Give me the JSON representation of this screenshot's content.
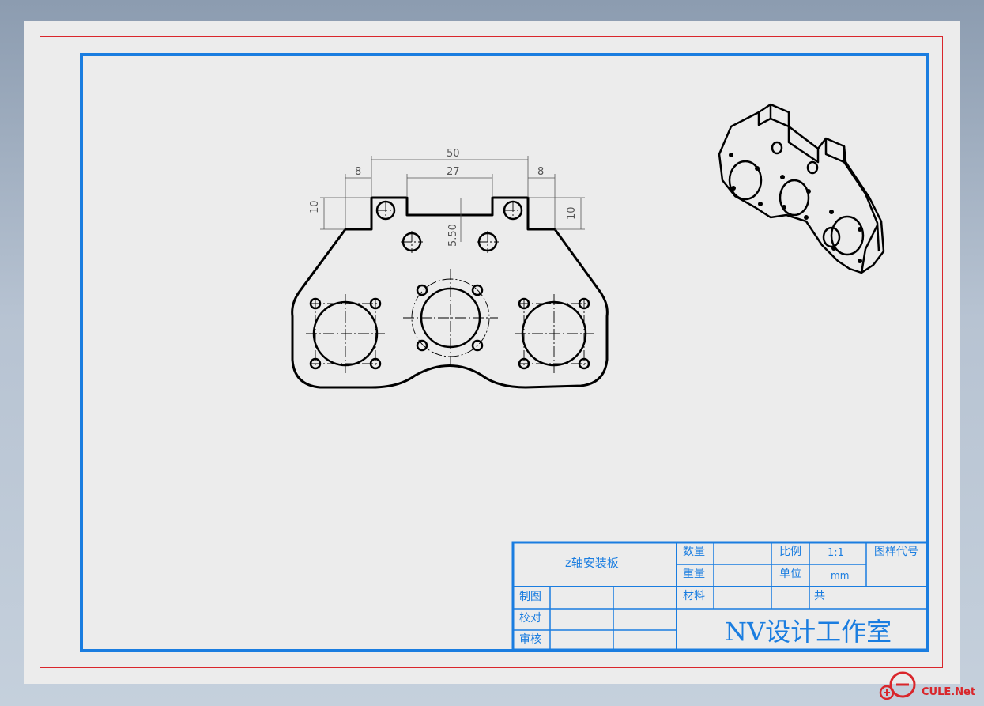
{
  "drawing": {
    "dimensions": {
      "overall_width": "50",
      "inner_width": "27",
      "left_offset": "8",
      "right_offset": "8",
      "left_height": "10",
      "right_height": "10",
      "hole_spacing": "5.50"
    }
  },
  "title_block": {
    "part_name": "z轴安装板",
    "quantity_label": "数量",
    "scale_label": "比例",
    "scale_value": "1:1",
    "drawing_no_label": "图样代号",
    "weight_label": "重量",
    "unit_label": "单位",
    "unit_value": "mm",
    "material_label": "材料",
    "total_label": "共",
    "drawn_label": "制图",
    "checked_label": "校对",
    "approved_label": "审核",
    "studio_name": "NV设计工作室"
  },
  "watermark": {
    "text": "CULE.Net"
  },
  "colors": {
    "frame_blue": "#1a7de0",
    "frame_red": "#d9262b",
    "sheet": "#ececec"
  }
}
